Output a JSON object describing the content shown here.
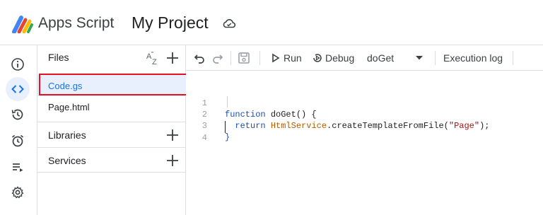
{
  "header": {
    "app_name": "Apps Script",
    "project_name": "My Project",
    "logo_icon": "apps-script-logo",
    "cloud_icon": "cloud-saved-icon"
  },
  "rail": {
    "items": [
      {
        "icon": "info-icon",
        "name": "Overview"
      },
      {
        "icon": "code-icon",
        "name": "Editor",
        "active": true
      },
      {
        "icon": "history-icon",
        "name": "Executions"
      },
      {
        "icon": "alarm-icon",
        "name": "Triggers"
      },
      {
        "icon": "playlist-icon",
        "name": "Executions list"
      },
      {
        "icon": "gear-icon",
        "name": "Project Settings"
      }
    ]
  },
  "files_panel": {
    "title": "Files",
    "files": [
      {
        "name": "Code.gs",
        "selected": true
      },
      {
        "name": "Page.html",
        "selected": false
      }
    ],
    "sections": [
      {
        "label": "Libraries"
      },
      {
        "label": "Services"
      }
    ]
  },
  "toolbar": {
    "run_label": "Run",
    "debug_label": "Debug",
    "function_select": "doGet",
    "execution_log_label": "Execution log"
  },
  "editor": {
    "lines": [
      {
        "num": "1",
        "text": "function doGet() {"
      },
      {
        "num": "2",
        "text": "  return HtmlService.createTemplateFromFile(\"Page\");"
      },
      {
        "num": "3",
        "text": "}"
      },
      {
        "num": "4",
        "text": ""
      }
    ]
  },
  "colors": {
    "accent": "#1a73e8",
    "selected_bg": "#e8f0fe",
    "highlight_border": "#e0141e"
  }
}
